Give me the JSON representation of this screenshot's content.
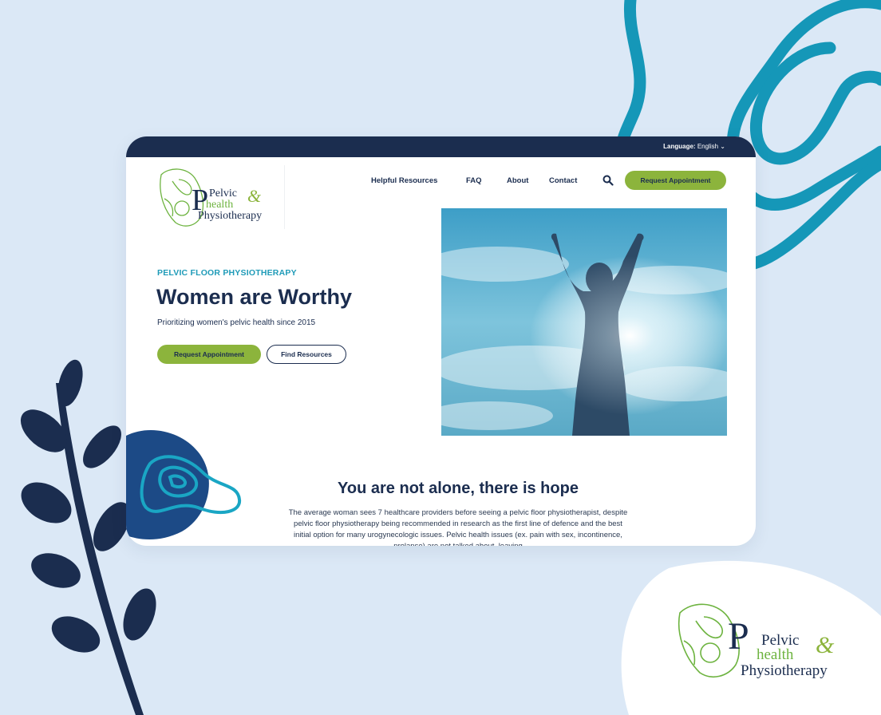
{
  "topbar": {
    "language_label": "Language:",
    "language_value": "English"
  },
  "logo": {
    "line1": "Pelvic",
    "line2": "health",
    "line3": "Physiotherapy",
    "ampersand": "&"
  },
  "nav": {
    "items": [
      "Helpful Resources",
      "FAQ",
      "About",
      "Contact"
    ],
    "cta": "Request Appointment"
  },
  "hero": {
    "eyebrow": "PELVIC FLOOR PHYSIOTHERAPY",
    "title": "Women are Worthy",
    "subtitle": "Prioritizing women's pelvic health since 2015",
    "primary_button": "Request Appointment",
    "secondary_button": "Find Resources"
  },
  "section": {
    "title": "You are not alone, there is hope",
    "paragraph": "The average woman sees 7 healthcare providers before seeing a pelvic floor physiotherapist, despite pelvic floor physiotherapy being recommended in research as the first line of defence and the best initial option for many urogynecologic issues.  Pelvic health issues (ex. pain with sex, incontinence, prolapse) are not talked about, leaving"
  },
  "colors": {
    "navy": "#1b2d4f",
    "green": "#8cb43c",
    "teal": "#1f9bb8",
    "background": "#dbe8f6"
  }
}
